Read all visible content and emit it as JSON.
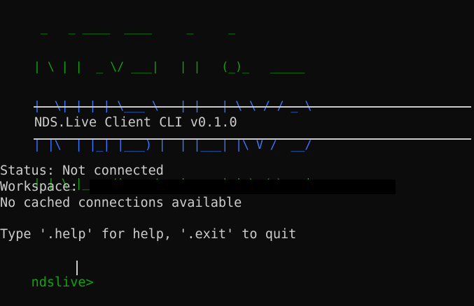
{
  "banner": {
    "line0": " _   _ ____  ____     _     _           ",
    "line1": "| \\ | |  _ \\/ ___|   | |   (_)_   _____ ",
    "line2": "|  \\| | | | \\___ \\   | |   | \\ \\ / / _ \\",
    "line3": "| |\\  | |_| |___) |  | |___| |\\ V /  __/",
    "line4": "|_| \\_|____/|____/   |_____|_| \\_/ \\___|"
  },
  "cli_title": "NDS.Live Client CLI v0.1.0",
  "status": {
    "status_text": "Status: Not connected",
    "workspace_label": "Workspace: ",
    "cache_text": "No cached connections available"
  },
  "help_text": "Type '.help' for help, '.exit' to quit",
  "prompt": {
    "label": "ndslive> ",
    "input_value": ""
  },
  "colors": {
    "background": "#0c0c0c",
    "text": "#cccccc",
    "green": "#13a10e",
    "blue": "#3b78ff"
  }
}
